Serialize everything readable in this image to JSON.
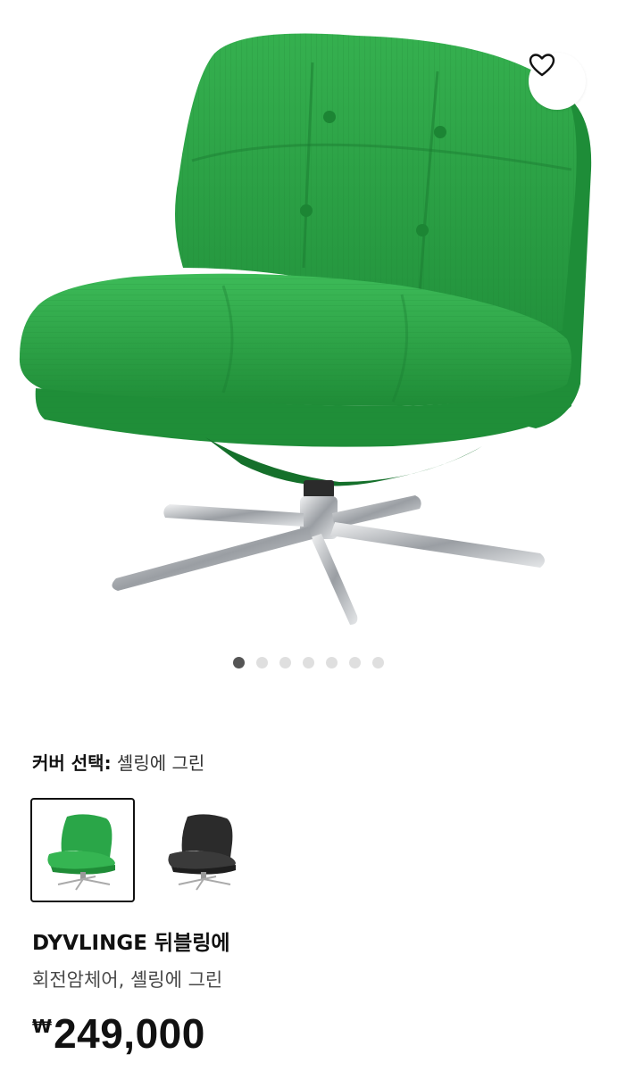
{
  "product": {
    "cover_label": "커버 선택:",
    "cover_value": "셸링에 그린",
    "name": "DYVLINGE 뒤블링에",
    "description": "회전암체어, 셸링에 그린",
    "currency_symbol": "₩",
    "price": "249,000"
  },
  "gallery": {
    "image_count": 7,
    "active_index": 0
  },
  "swatches": [
    {
      "name": "셸링에 그린",
      "color": "#27a64a",
      "selected": true
    },
    {
      "name": "black",
      "color": "#2d2d2d",
      "selected": false
    }
  ],
  "colors": {
    "chair_green": "#2fa84a",
    "chair_green_dark": "#1f8a38",
    "chrome": "#b9bcc0",
    "active_dot": "#555555",
    "inactive_dot": "#dfdfdf"
  },
  "icons": {
    "favorite": "heart-icon"
  }
}
